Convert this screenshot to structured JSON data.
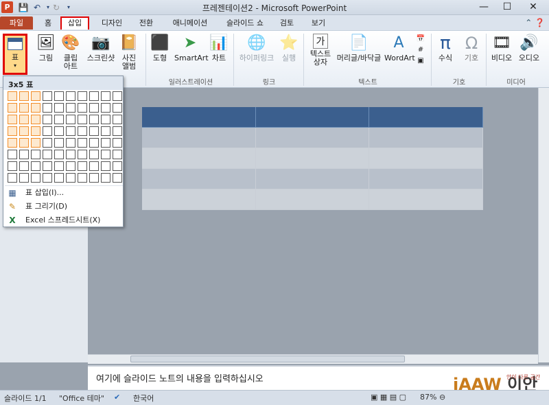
{
  "window": {
    "title": "프레젠테이션2 - Microsoft PowerPoint",
    "app_icon": "P",
    "minimize": "—",
    "maximize": "☐",
    "close": "✕"
  },
  "tabs": [
    {
      "label": "파일"
    },
    {
      "label": "홈"
    },
    {
      "label": "삽입"
    },
    {
      "label": "디자인"
    },
    {
      "label": "전환"
    },
    {
      "label": "애니메이션"
    },
    {
      "label": "슬라이드 쇼"
    },
    {
      "label": "검토"
    },
    {
      "label": "보기"
    }
  ],
  "ribbon": {
    "table": "표",
    "picture": "그림",
    "clipart_1": "클립",
    "clipart_2": "아트",
    "screenshot": "스크린샷",
    "photo_album_1": "사진",
    "photo_album_2": "앨범",
    "shapes": "도형",
    "smartart": "SmartArt",
    "chart": "차트",
    "hyperlink": "하이퍼링크",
    "action": "실행",
    "textbox_1": "텍스트",
    "textbox_2": "상자",
    "header_footer": "머리글/바닥글",
    "wordart": "WordArt",
    "equation": "수식",
    "symbol": "기호",
    "video": "비디오",
    "audio": "오디오",
    "groups": {
      "illustrations": "일러스트레이션",
      "links": "링크",
      "text": "텍스트",
      "symbols": "기호",
      "media": "미디어"
    }
  },
  "dropdown": {
    "title": "3x5 표",
    "selected_cols": 3,
    "selected_rows": 5,
    "grid_cols": 10,
    "grid_rows": 8,
    "items": [
      {
        "icon": "table-icon",
        "label": "표 삽입(I)..."
      },
      {
        "icon": "pencil-icon",
        "label": "표 그리기(D)"
      },
      {
        "icon": "excel-icon",
        "label": "Excel 스프레드시트(X)"
      }
    ]
  },
  "notes": {
    "placeholder": "여기에 슬라이드 노트의 내용을 입력하십시오"
  },
  "status": {
    "slide": "슬라이드 1/1",
    "theme": "\"Office 테마\"",
    "language": "한국어",
    "zoom": "87%"
  },
  "watermark": {
    "main": "iAAW",
    "sub": "이안",
    "tag": "안이 다른 공간"
  },
  "colors": {
    "accent": "#b7472a",
    "highlight": "#e00000",
    "table_header": "#3b5f8e",
    "grid_selected": "#f28c28"
  }
}
